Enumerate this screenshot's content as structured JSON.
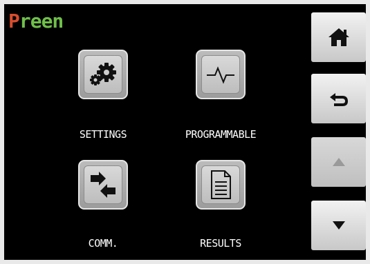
{
  "brand": {
    "first_letter": "P",
    "rest": "reen"
  },
  "menu": [
    {
      "label": "SETTINGS",
      "icon": "settings-gears-icon"
    },
    {
      "label": "PROGRAMMABLE",
      "icon": "waveform-icon"
    },
    {
      "label": "COMM.",
      "icon": "transfer-arrows-icon"
    },
    {
      "label": "RESULTS",
      "icon": "document-icon"
    }
  ],
  "side_buttons": [
    {
      "icon": "home-icon",
      "enabled": true
    },
    {
      "icon": "back-icon",
      "enabled": true
    },
    {
      "icon": "up-arrow-icon",
      "enabled": false
    },
    {
      "icon": "down-arrow-icon",
      "enabled": true
    }
  ],
  "colors": {
    "brand_p": "#d84c2d",
    "brand_rest": "#6fbf4a",
    "screen_bg": "#000000",
    "tile": "#b0b0b0"
  }
}
